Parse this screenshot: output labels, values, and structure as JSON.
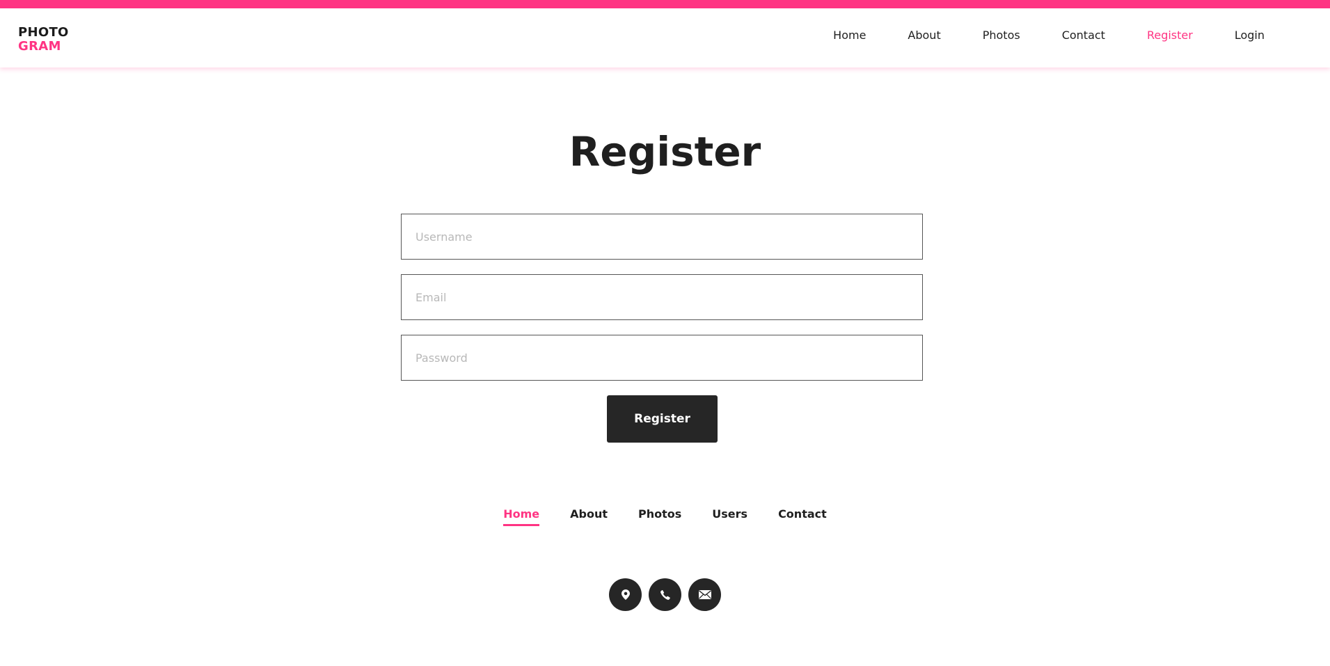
{
  "brand": {
    "line1": "PHOTO",
    "line2": "GRAM",
    "accent": "#ff3483"
  },
  "nav": {
    "items": [
      {
        "label": "Home"
      },
      {
        "label": "About"
      },
      {
        "label": "Photos"
      },
      {
        "label": "Contact"
      },
      {
        "label": "Register",
        "active": true
      },
      {
        "label": "Login"
      }
    ]
  },
  "page": {
    "title": "Register"
  },
  "form": {
    "username": {
      "placeholder": "Username",
      "value": ""
    },
    "email": {
      "placeholder": "Email",
      "value": ""
    },
    "password": {
      "placeholder": "Password",
      "value": ""
    },
    "submit_label": "Register"
  },
  "footer": {
    "nav": [
      {
        "label": "Home",
        "active": true
      },
      {
        "label": "About"
      },
      {
        "label": "Photos"
      },
      {
        "label": "Users"
      },
      {
        "label": "Contact"
      }
    ],
    "social_icons": [
      "location-pin-icon",
      "phone-icon",
      "envelope-icon"
    ]
  }
}
